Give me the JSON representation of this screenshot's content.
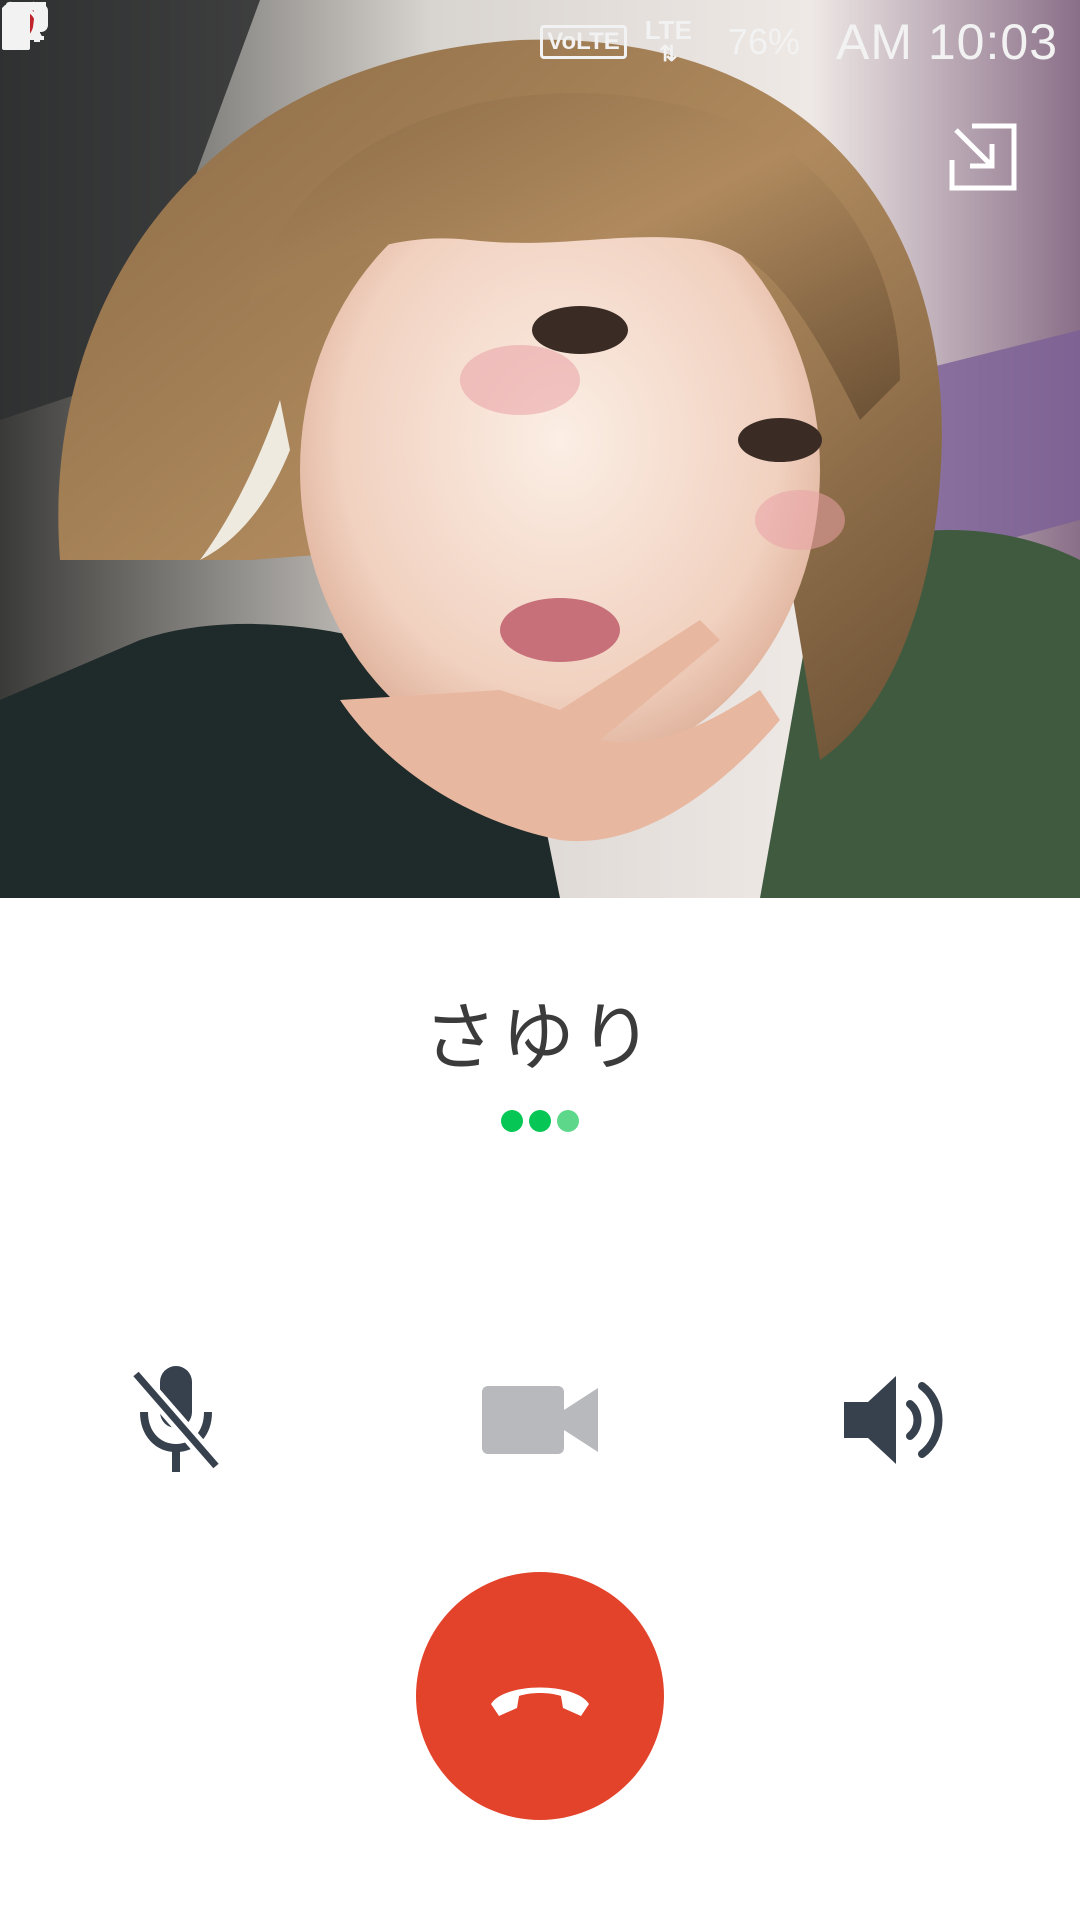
{
  "status_bar": {
    "icons_left": [
      "message-icon",
      "alert-card-icon",
      "missed-call-icon",
      "warning-icon",
      "mcafee-shield-icon"
    ],
    "icons_right": [
      "alarm-icon",
      "volte-icon",
      "lte-icon",
      "signal-icon",
      "battery-icon"
    ],
    "volte_label": "VoLTE",
    "lte_label": "LTE",
    "battery": "76%",
    "time": "AM 10:03"
  },
  "call": {
    "caller_name": "さゆり",
    "status_dots": 3,
    "colors": {
      "dot_dark": "#06c755",
      "dot_mid": "#06c755",
      "dot_light": "#5dd88a",
      "end_call": "#e3432a",
      "icon_dark": "#37404d",
      "icon_disabled": "#b7b9bd"
    }
  },
  "controls": {
    "mute": {
      "icon": "mic-off-icon",
      "state": "muted"
    },
    "video": {
      "icon": "video-camera-icon",
      "state": "disabled"
    },
    "speaker": {
      "icon": "speaker-icon",
      "state": "on"
    },
    "end_call": {
      "icon": "phone-hangup-icon"
    },
    "minimize": {
      "icon": "minimize-arrow-icon"
    }
  }
}
